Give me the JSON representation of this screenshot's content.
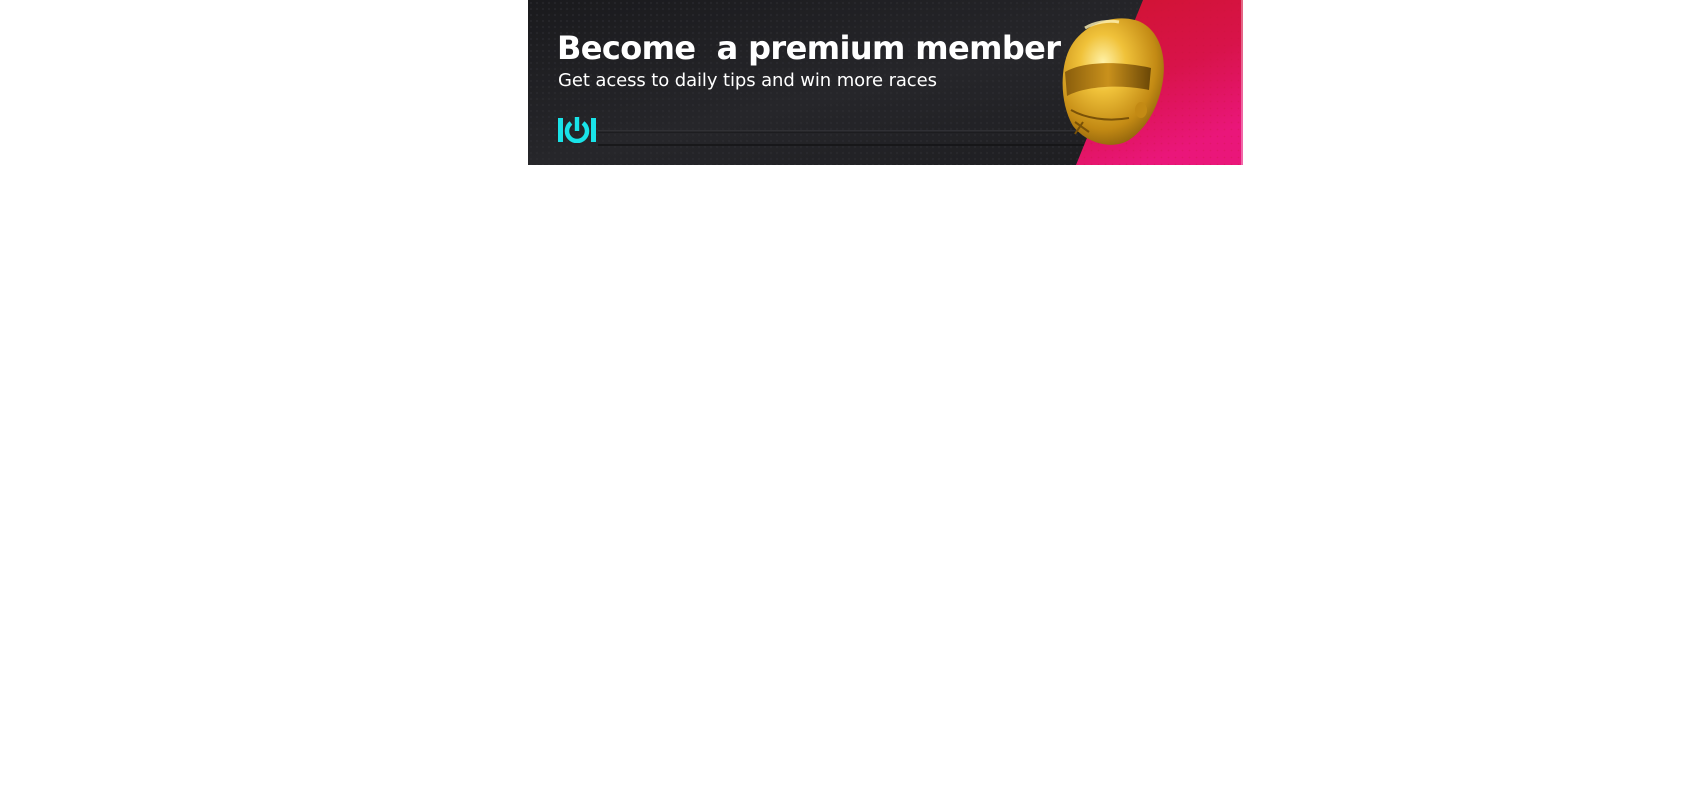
{
  "banner": {
    "headline": "Become  a premium member",
    "subline": "Get acess to daily tips and win more races",
    "logo_icon": "power-logo-icon",
    "helmet_icon": "racing-helmet-icon",
    "colors": {
      "background": "#1d1d20",
      "accent_red": "#d4113a",
      "accent_pink": "#e8146e",
      "logo_cyan": "#19e3e8",
      "helmet_gold": "#d9a520",
      "text": "#ffffff"
    }
  }
}
